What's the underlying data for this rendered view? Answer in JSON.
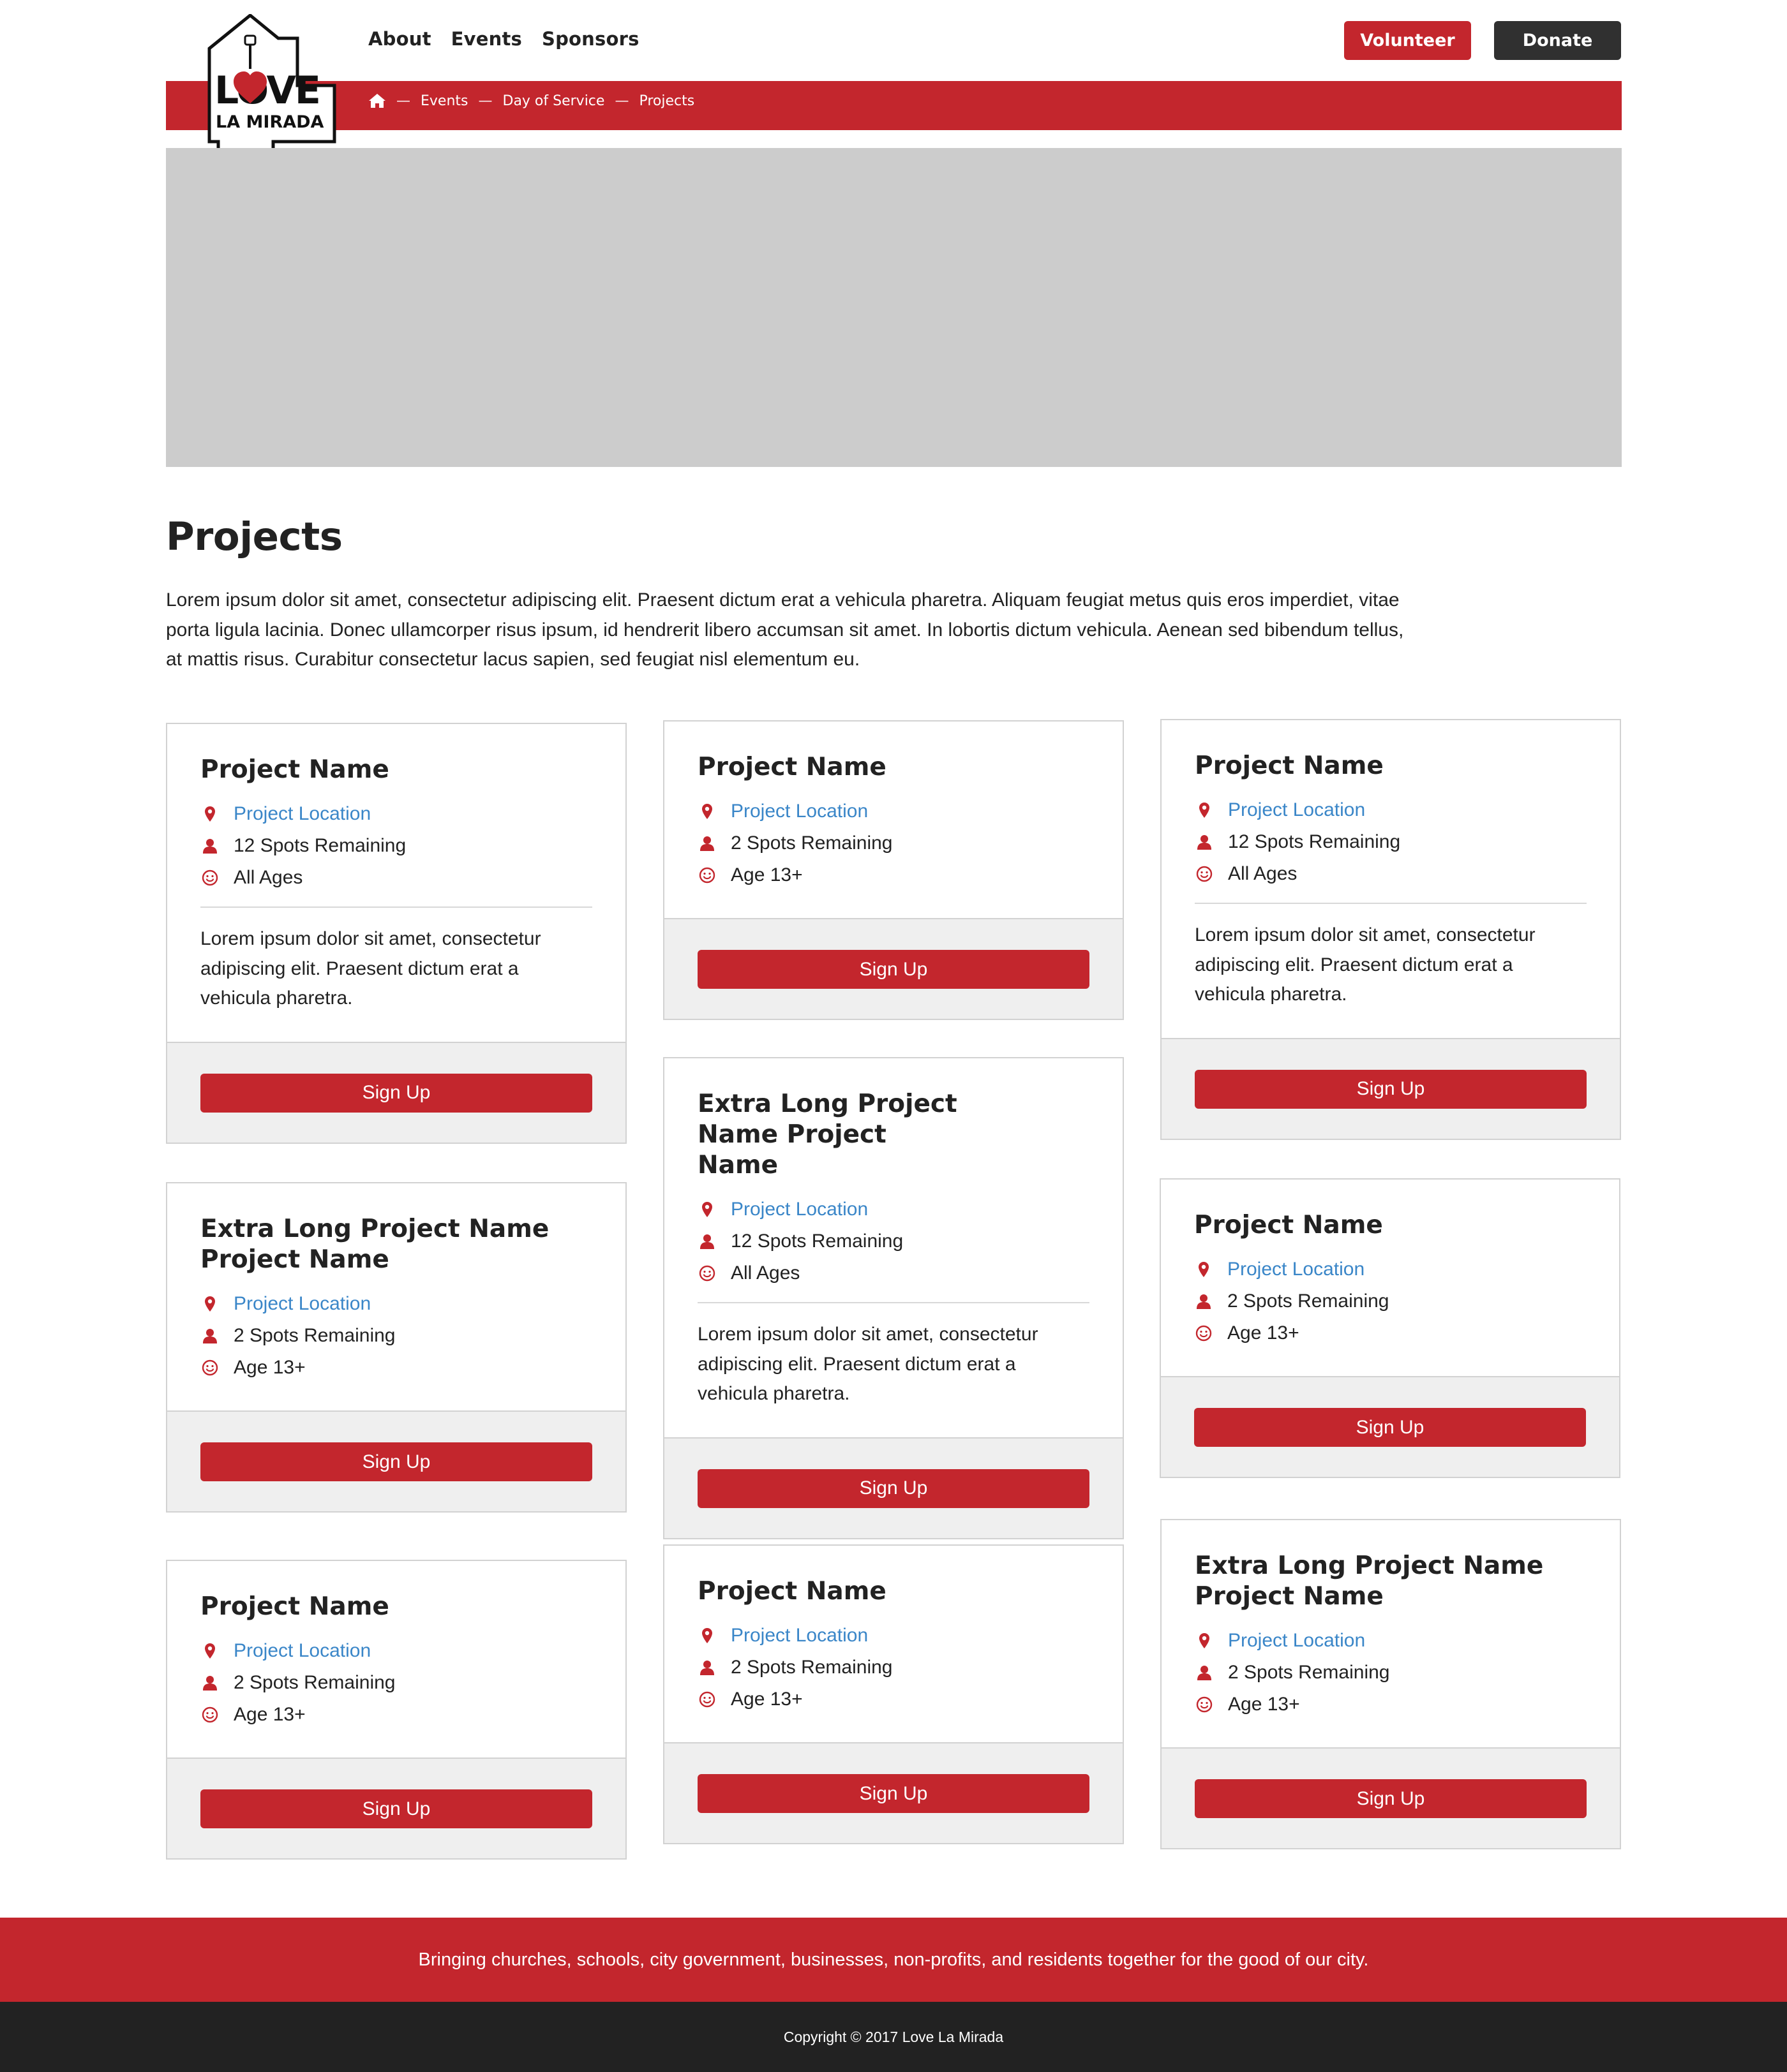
{
  "logo": {
    "line1": "LOVE",
    "line2": "LA MIRADA"
  },
  "nav": {
    "items": [
      {
        "label": "About"
      },
      {
        "label": "Events"
      },
      {
        "label": "Sponsors"
      }
    ],
    "volunteer_label": "Volunteer",
    "donate_label": "Donate"
  },
  "breadcrumb": {
    "separator": "—",
    "items": [
      {
        "label": "Events"
      },
      {
        "label": "Day of Service"
      },
      {
        "label": "Projects"
      }
    ]
  },
  "page": {
    "title": "Projects",
    "intro": "Lorem ipsum dolor sit amet, consectetur adipiscing elit. Praesent dictum erat a vehicula pharetra. Aliquam feugiat metus quis eros imperdiet, vitae porta ligula lacinia. Donec ullamcorper risus ipsum, id hendrerit libero accumsan sit amet. In lobortis dictum vehicula. Aenean sed bibendum tellus, at mattis risus. Curabitur consectetur lacus sapien, sed feugiat nisl elementum eu."
  },
  "cards": [
    {
      "title": "Project Name",
      "location": "Project Location",
      "spots": "12 Spots Remaining",
      "age": "All Ages",
      "desc": "Lorem ipsum dolor sit amet, consectetur adipiscing elit. Praesent dictum erat a vehicula pharetra.",
      "button": "Sign Up"
    },
    {
      "title": "Project Name",
      "location": "Project Location",
      "spots": "2 Spots Remaining",
      "age": "Age 13+",
      "desc": "",
      "button": "Sign Up"
    },
    {
      "title": "Project Name",
      "location": "Project Location",
      "spots": "12 Spots Remaining",
      "age": "All Ages",
      "desc": "Lorem ipsum dolor sit amet, consectetur adipiscing elit. Praesent dictum erat a vehicula pharetra.",
      "button": "Sign Up"
    },
    {
      "title": "Extra Long Project Name Project Name",
      "location": "Project Location",
      "spots": "2 Spots Remaining",
      "age": "Age 13+",
      "desc": "",
      "button": "Sign Up"
    },
    {
      "title": "Extra Long Project Name Project Name",
      "location": "Project Location",
      "spots": "12 Spots Remaining",
      "age": "All Ages",
      "desc": "Lorem ipsum dolor sit amet, consectetur adipiscing elit. Praesent dictum erat a vehicula pharetra.",
      "button": "Sign Up"
    },
    {
      "title": "Project Name",
      "location": "Project Location",
      "spots": "2 Spots Remaining",
      "age": "Age 13+",
      "desc": "",
      "button": "Sign Up"
    },
    {
      "title": "Project Name",
      "location": "Project Location",
      "spots": "2 Spots Remaining",
      "age": "Age 13+",
      "desc": "",
      "button": "Sign Up"
    },
    {
      "title": "Project Name",
      "location": "Project Location",
      "spots": "2 Spots Remaining",
      "age": "Age 13+",
      "desc": "",
      "button": "Sign Up"
    },
    {
      "title": "Extra Long Project Name Project Name",
      "location": "Project Location",
      "spots": "2 Spots Remaining",
      "age": "Age 13+",
      "desc": "",
      "button": "Sign Up"
    }
  ],
  "footer": {
    "tagline": "Bringing churches, schools, city government, businesses, non-profits, and residents together for the good of our city.",
    "copyright": "Copyright © 2017 Love La Mirada"
  },
  "colors": {
    "brand_red": "#c3262d",
    "dark": "#303030",
    "link_blue": "#3a86c8",
    "hero_gray": "#cccccc"
  },
  "icons": {
    "location": "map-pin-icon",
    "spots": "user-icon",
    "age": "smiley-icon",
    "home": "home-icon"
  }
}
